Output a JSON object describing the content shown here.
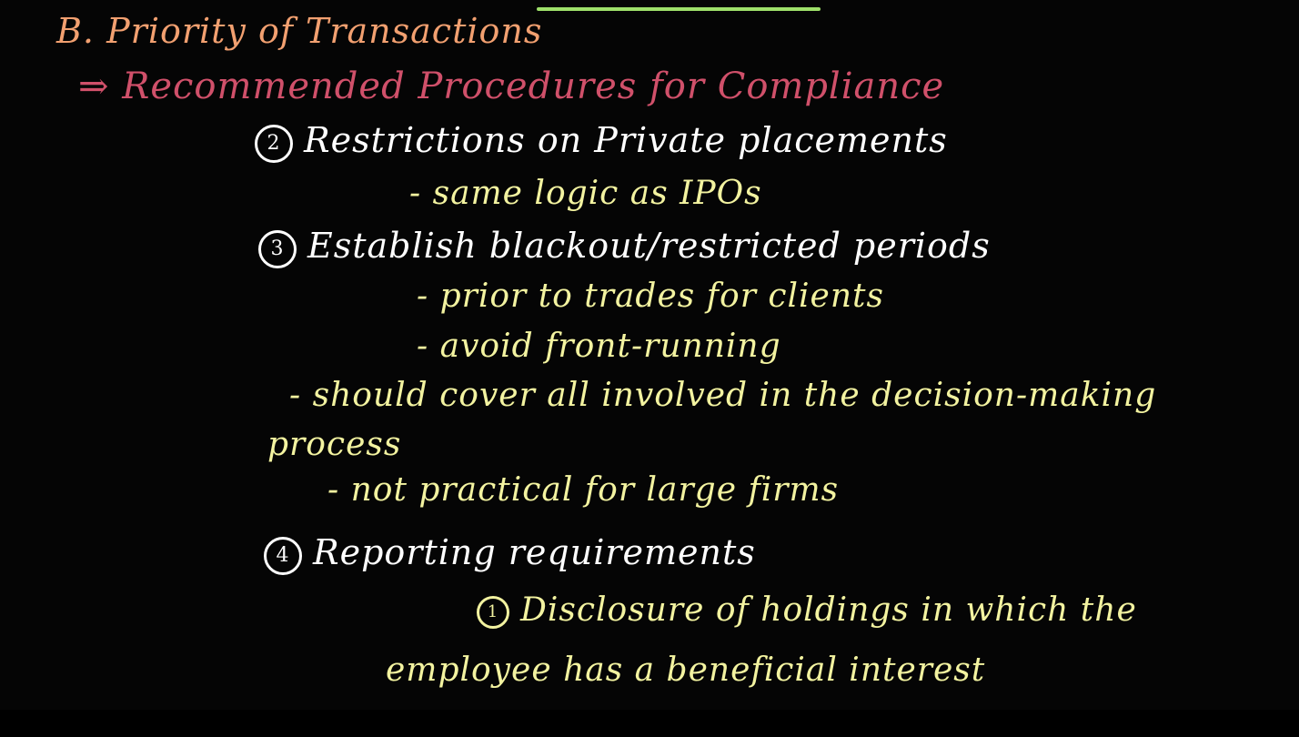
{
  "notes": {
    "title": "B. Priority of Transactions",
    "subtitle": "⇒ Recommended Procedures for Compliance",
    "item2": {
      "num": "2",
      "text": "Restrictions on Private placements"
    },
    "item2_sub": "- same logic as IPOs",
    "item3": {
      "num": "3",
      "text": "Establish blackout/restricted periods"
    },
    "item3_sub1": "- prior to trades for clients",
    "item3_sub2": "- avoid front-running",
    "item3_sub3": "- should cover all involved in the decision-making",
    "item3_sub3_cont": "process",
    "item3_sub4": "- not practical for large firms",
    "item4": {
      "num": "4",
      "text": "Reporting requirements"
    },
    "item4_sub1": {
      "num": "1",
      "text": "Disclosure of holdings in which the"
    },
    "item4_sub1_cont": "employee has a beneficial interest"
  },
  "colors": {
    "heading": "#f2a070",
    "subheading": "#d0506a",
    "white": "#ffffff",
    "yellow": "#f3f3a0",
    "accent_line": "#9ee06a"
  }
}
